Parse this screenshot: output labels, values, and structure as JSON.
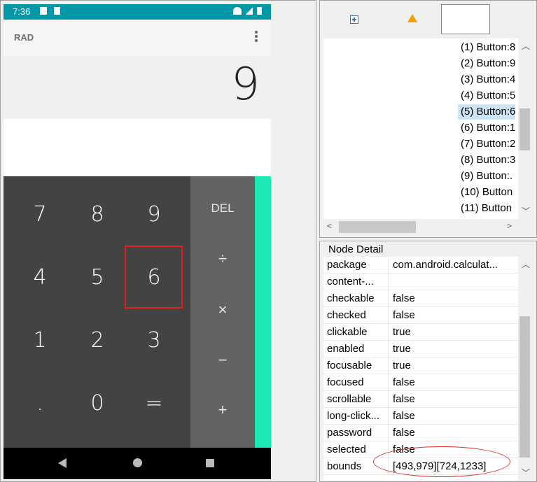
{
  "phone": {
    "status_time": "7:36",
    "mode": "RAD",
    "display_value": "9",
    "keypad": [
      [
        "7",
        "8",
        "9"
      ],
      [
        "4",
        "5",
        "6"
      ],
      [
        "1",
        "2",
        "3"
      ],
      [
        ".",
        "0",
        "="
      ]
    ],
    "operators": [
      "DEL",
      "÷",
      "×",
      "−",
      "+"
    ]
  },
  "tree": {
    "items": [
      "(1) Button:8",
      "(2) Button:9",
      "(3) Button:4",
      "(4) Button:5",
      "(5) Button:6",
      "(6) Button:1",
      "(7) Button:2",
      "(8) Button:3",
      "(9) Button:.",
      "(10) Button",
      "(11) Button"
    ],
    "selected_index": 4
  },
  "detail": {
    "title": "Node Detail",
    "rows": [
      {
        "key": "package",
        "value": "com.android.calculat..."
      },
      {
        "key": "content-...",
        "value": ""
      },
      {
        "key": "checkable",
        "value": "false"
      },
      {
        "key": "checked",
        "value": "false"
      },
      {
        "key": "clickable",
        "value": "true"
      },
      {
        "key": "enabled",
        "value": "true"
      },
      {
        "key": "focusable",
        "value": "true"
      },
      {
        "key": "focused",
        "value": "false"
      },
      {
        "key": "scrollable",
        "value": "false"
      },
      {
        "key": "long-click...",
        "value": "false"
      },
      {
        "key": "password",
        "value": "false"
      },
      {
        "key": "selected",
        "value": "false"
      },
      {
        "key": "bounds",
        "value": "[493,979][724,1233]"
      }
    ]
  }
}
